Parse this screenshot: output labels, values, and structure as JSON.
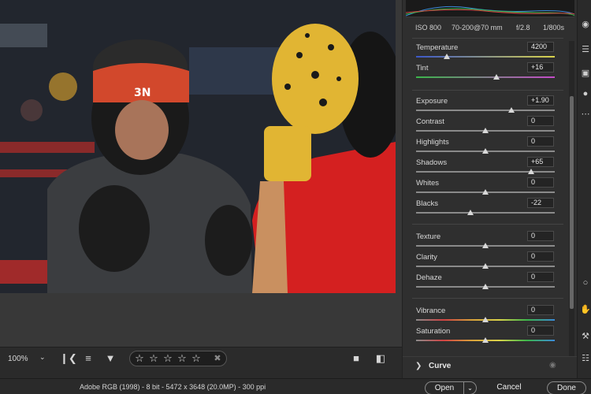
{
  "toolbar": {
    "zoom": "100%",
    "zoom_caret": "⌄",
    "filmstrip_icon": "❙❮",
    "sort_icon": "≡",
    "filter_icon": "▼",
    "stars": [
      "☆",
      "☆",
      "☆",
      "☆",
      "☆"
    ],
    "trash_icon": "✖",
    "view_single_icon": "■",
    "compare_icon": "◧"
  },
  "camera": {
    "iso": "ISO 800",
    "lens": "70-200@70 mm",
    "aperture": "f/2.8",
    "shutter": "1/800s"
  },
  "sliders": [
    {
      "label": "Temperature",
      "value": "4200",
      "pos": 0.22,
      "gradient": "linear-gradient(90deg,#3b57c9,#d9d34a)"
    },
    {
      "label": "Tint",
      "value": "+16",
      "pos": 0.58,
      "gradient": "linear-gradient(90deg,#3bb54a,#c54bc9)"
    },
    {
      "label": "Exposure",
      "value": "+1.90",
      "pos": 0.69,
      "gradient": ""
    },
    {
      "label": "Contrast",
      "value": "0",
      "pos": 0.5,
      "gradient": ""
    },
    {
      "label": "Highlights",
      "value": "0",
      "pos": 0.5,
      "gradient": ""
    },
    {
      "label": "Shadows",
      "value": "+65",
      "pos": 0.83,
      "gradient": ""
    },
    {
      "label": "Whites",
      "value": "0",
      "pos": 0.5,
      "gradient": ""
    },
    {
      "label": "Blacks",
      "value": "-22",
      "pos": 0.39,
      "gradient": ""
    },
    {
      "label": "Texture",
      "value": "0",
      "pos": 0.5,
      "gradient": ""
    },
    {
      "label": "Clarity",
      "value": "0",
      "pos": 0.5,
      "gradient": ""
    },
    {
      "label": "Dehaze",
      "value": "0",
      "pos": 0.5,
      "gradient": ""
    },
    {
      "label": "Vibrance",
      "value": "0",
      "pos": 0.5,
      "gradient": "linear-gradient(90deg,#8a8a8a,#d14343,#d8a03a,#d9d34a,#3bb54a,#3b8ad9)"
    },
    {
      "label": "Saturation",
      "value": "0",
      "pos": 0.5,
      "gradient": "linear-gradient(90deg,#8a8a8a,#d14343,#d8a03a,#d9d34a,#3bb54a,#3b8ad9)"
    }
  ],
  "panel": {
    "curve_label": "Curve",
    "curve_chevron": "❯",
    "eye_icon": "◉"
  },
  "tools": [
    "◉",
    "☰",
    "▣",
    "●",
    "⋯",
    "○",
    "✋",
    "⚒",
    "☷"
  ],
  "status": {
    "info": "Adobe RGB (1998) - 8 bit - 5472 x 3648 (20.0MP) - 300 ppi",
    "open": "Open",
    "open_menu": "⌄",
    "cancel": "Cancel",
    "done": "Done"
  }
}
